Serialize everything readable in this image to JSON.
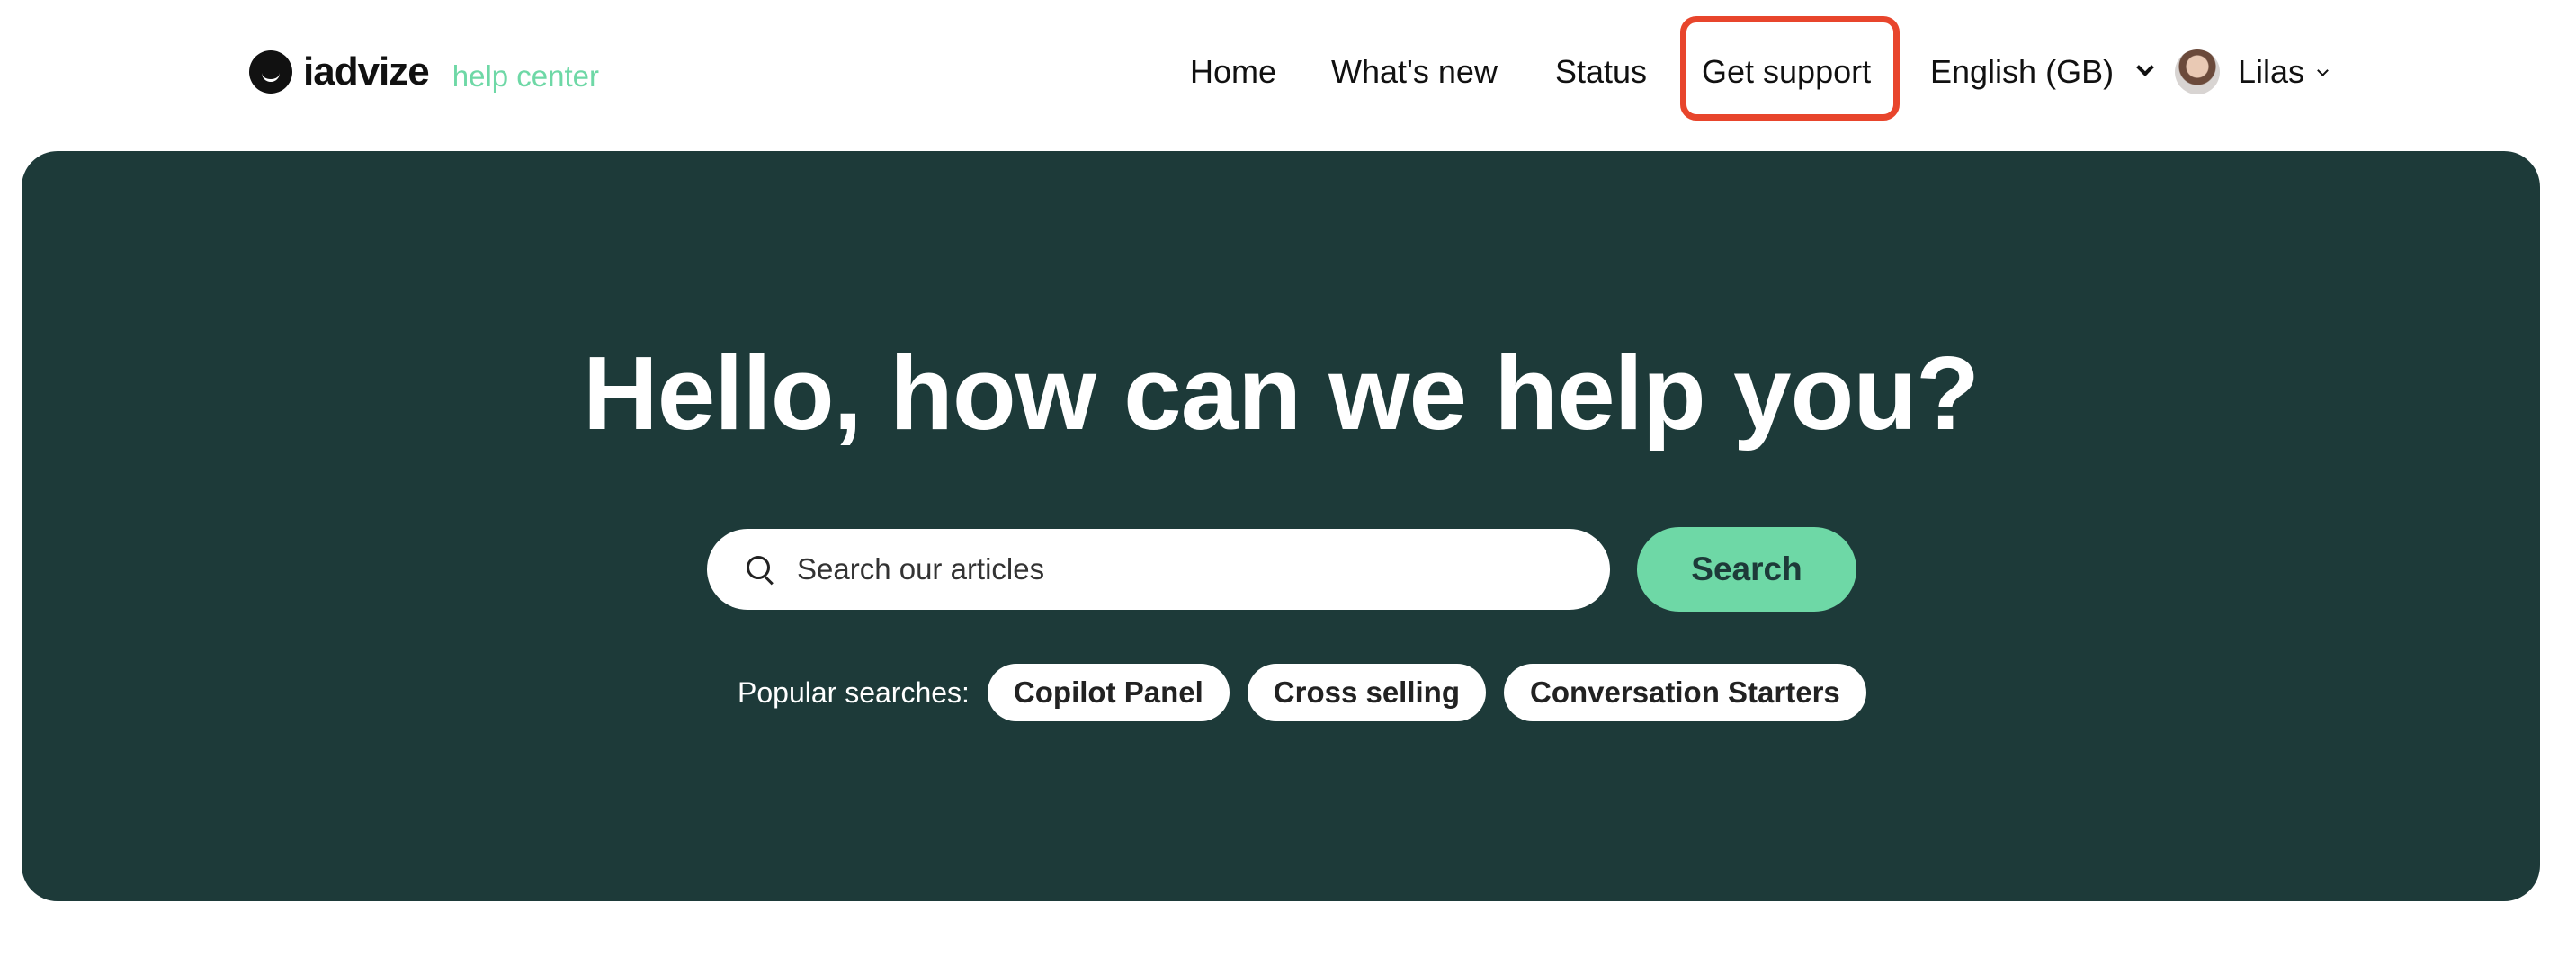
{
  "header": {
    "logo": {
      "wordmark": "iadvize",
      "subtitle": "help center"
    },
    "nav": {
      "home": "Home",
      "whats_new": "What's new",
      "status": "Status",
      "get_support": "Get support",
      "language": "English (GB)",
      "user_name": "Lilas"
    }
  },
  "hero": {
    "title": "Hello, how can we help you?",
    "search": {
      "placeholder": "Search our articles",
      "value": "",
      "button_label": "Search"
    },
    "popular": {
      "label": "Popular searches:",
      "items": [
        "Copilot Panel",
        "Cross selling",
        "Conversation Starters"
      ]
    }
  },
  "colors": {
    "hero_background": "#1d3a39",
    "accent_green": "#6ed8a6",
    "highlight_red": "#e8452c"
  }
}
